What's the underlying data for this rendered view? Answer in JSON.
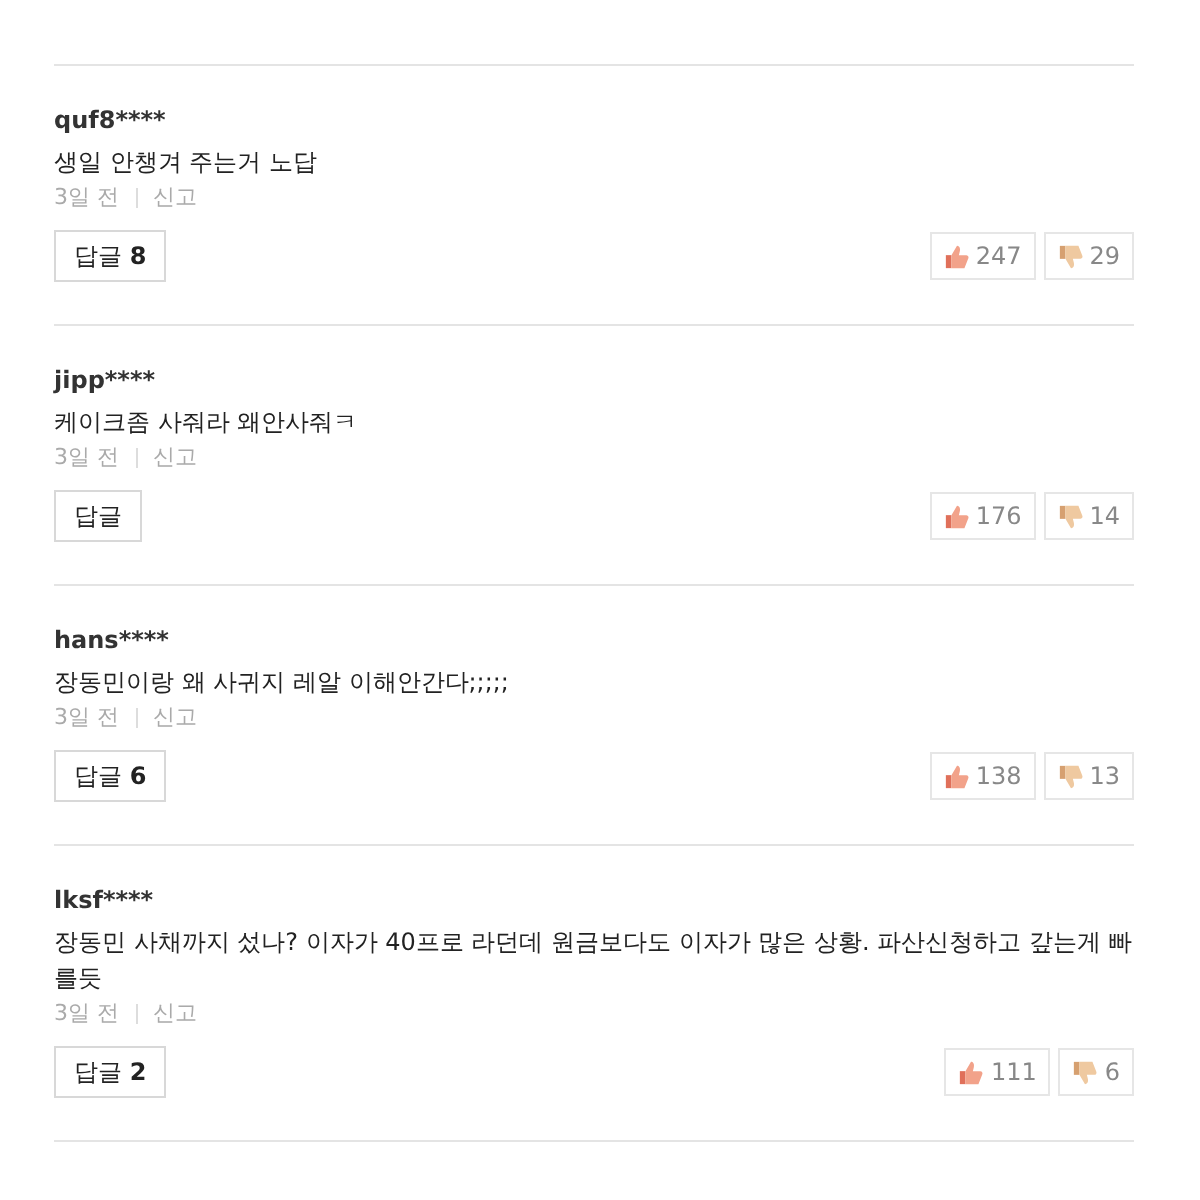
{
  "comments": [
    {
      "user": "quf8****",
      "text": "생일 안챙겨 주는거 노답",
      "time": "3일 전",
      "report": "신고",
      "reply_label": "답글",
      "reply_count": "8",
      "likes": "247",
      "dislikes": "29"
    },
    {
      "user": "jipp****",
      "text": "케이크좀 사줘라 왜안사줘ㅋ",
      "time": "3일 전",
      "report": "신고",
      "reply_label": "답글",
      "likes": "176",
      "dislikes": "14"
    },
    {
      "user": "hans****",
      "text": "장동민이랑 왜 사귀지 레알 이해안간다;;;;;",
      "time": "3일 전",
      "report": "신고",
      "reply_label": "답글",
      "reply_count": "6",
      "likes": "138",
      "dislikes": "13"
    },
    {
      "user": "lksf****",
      "text": "장동민 사채까지 섰나? 이자가 40프로 라던데 원금보다도 이자가 많은 상황. 파산신청하고 갚는게 빠를듯",
      "time": "3일 전",
      "report": "신고",
      "reply_label": "답글",
      "reply_count": "2",
      "likes": "111",
      "dislikes": "6"
    }
  ]
}
